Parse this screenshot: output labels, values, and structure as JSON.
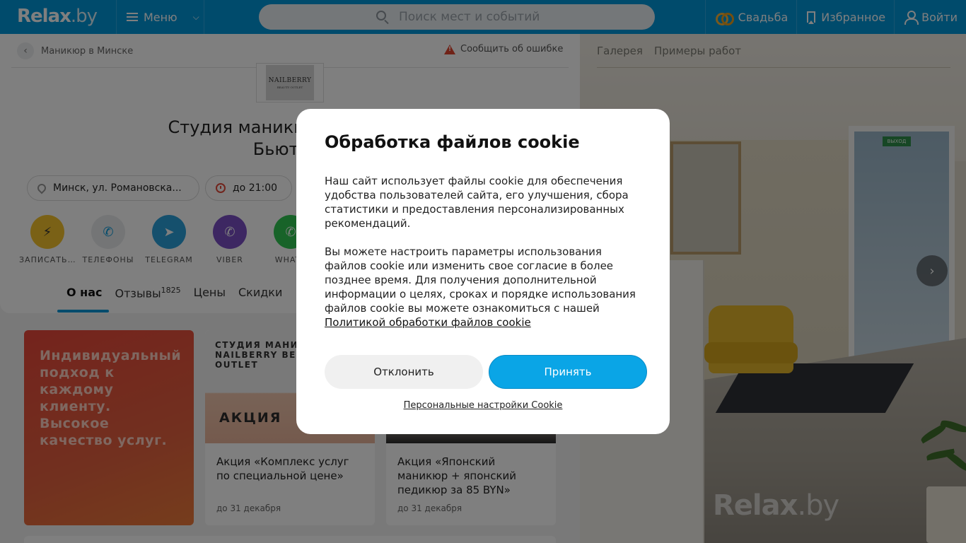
{
  "header": {
    "logo_main": "Relax",
    "logo_suffix": ".by",
    "menu_label": "Меню",
    "search_placeholder": "Поиск мест и событий",
    "wedding_label": "Свадьба",
    "favorites_label": "Избранное",
    "login_label": "Войти"
  },
  "breadcrumb": {
    "label": "Маникюр в Минске",
    "report_label": "Сообщить об ошибке"
  },
  "place": {
    "logo_line1": "NAILBERRY",
    "logo_line2": "BEAUTY OUTLET",
    "title_line1": "Студия маникюра Nailberry",
    "title_line2": "Бьюти А",
    "address": "Минск, ул. Романовска...",
    "hours": "до 21:00"
  },
  "actions": [
    {
      "label": "ЗАПИСАТЬ...",
      "icon": "bolt-icon",
      "color": "#f4c32d"
    },
    {
      "label": "ТЕЛЕФОНЫ",
      "icon": "phone-icon",
      "color": "#e8eaec"
    },
    {
      "label": "TELEGRAM",
      "icon": "telegram-icon",
      "color": "#2aa0da"
    },
    {
      "label": "VIBER",
      "icon": "viber-icon",
      "color": "#7a4fc4"
    },
    {
      "label": "WHATS",
      "icon": "whatsapp-icon",
      "color": "#31c653"
    }
  ],
  "tabs": [
    {
      "label": "О нас"
    },
    {
      "label": "Отзывы",
      "count": "1825"
    },
    {
      "label": "Цены"
    },
    {
      "label": "Скидки"
    }
  ],
  "promos": {
    "red_card_text": "Индивидуальный подход к каждому клиенту. Высокое качество услуг.",
    "card1": {
      "studio": "СТУДИЯ МАНИКЮРА NAILBERRY BEAUTY OUTLET",
      "badge": "АКЦИЯ",
      "title": "Акция «Комплекс услуг по специальной цене»",
      "date": "до 31 декабря"
    },
    "card2": {
      "title": "Акция «Японский маникюр + японский педикюр за 85 BYN»",
      "date": "до 31 декабря"
    }
  },
  "gallery": {
    "tab1": "Галерея",
    "tab2": "Примеры работ",
    "exit_sign": "ВЫХОД",
    "watermark_main": "Relax",
    "watermark_suffix": ".by"
  },
  "cookie_modal": {
    "title": "Обработка файлов cookie",
    "paragraph1": "Наш сайт использует файлы cookie для обеспечения удобства пользователей сайта, его улучшения, сбора статистики и предоставления персонализированных рекомендаций.",
    "paragraph2": "Вы можете настроить параметры использования файлов cookie или изменить свое согласие в более позднее время. Для получения дополнительной информации о целях, сроках и порядке использования файлов cookie вы можете ознакомиться с нашей",
    "policy_link": "Политикой обработки файлов cookie",
    "decline_label": "Отклонить",
    "accept_label": "Принять",
    "personal_settings_label": "Персональные настройки Cookie"
  },
  "colors": {
    "brand_blue": "#0096d9",
    "accept_blue": "#0aa5e6",
    "promo_red": "#e9473a"
  }
}
